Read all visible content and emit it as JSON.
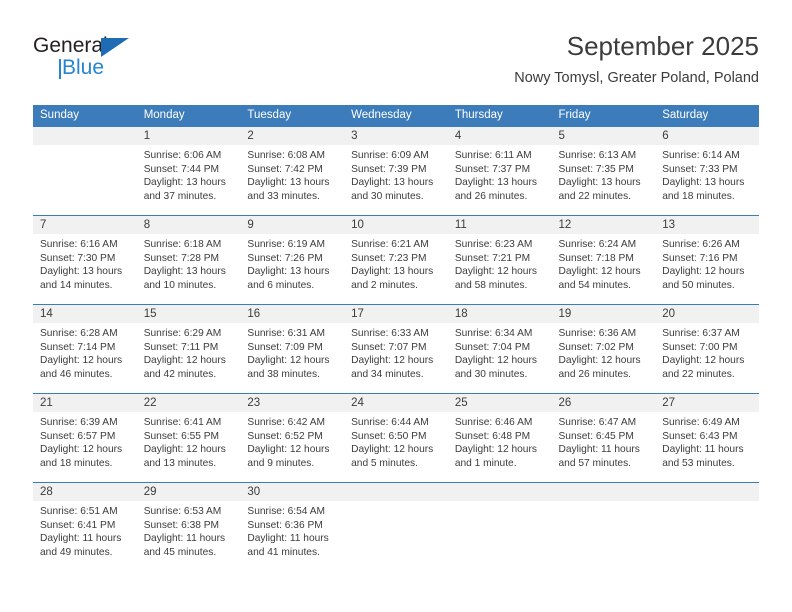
{
  "logo": {
    "primary_text": "General",
    "secondary_text": "Blue",
    "primary_color": "#231f20",
    "accent_color": "#2585d3",
    "triangle_color": "#1f6cb4"
  },
  "header": {
    "title": "September 2025",
    "subtitle": "Nowy Tomysl, Greater Poland, Poland"
  },
  "theme": {
    "header_row_bg": "#3d7cbb",
    "header_row_text": "#ffffff",
    "day_number_bg": "#f1f1f1",
    "cell_text": "#3c3c3c",
    "grid_line": "#3d7cbb"
  },
  "weekday_headers": [
    "Sunday",
    "Monday",
    "Tuesday",
    "Wednesday",
    "Thursday",
    "Friday",
    "Saturday"
  ],
  "weeks": [
    [
      {
        "day": "",
        "sunrise": "",
        "sunset": "",
        "daylight_line1": "",
        "daylight_line2": ""
      },
      {
        "day": "1",
        "sunrise": "Sunrise: 6:06 AM",
        "sunset": "Sunset: 7:44 PM",
        "daylight_line1": "Daylight: 13 hours",
        "daylight_line2": "and 37 minutes."
      },
      {
        "day": "2",
        "sunrise": "Sunrise: 6:08 AM",
        "sunset": "Sunset: 7:42 PM",
        "daylight_line1": "Daylight: 13 hours",
        "daylight_line2": "and 33 minutes."
      },
      {
        "day": "3",
        "sunrise": "Sunrise: 6:09 AM",
        "sunset": "Sunset: 7:39 PM",
        "daylight_line1": "Daylight: 13 hours",
        "daylight_line2": "and 30 minutes."
      },
      {
        "day": "4",
        "sunrise": "Sunrise: 6:11 AM",
        "sunset": "Sunset: 7:37 PM",
        "daylight_line1": "Daylight: 13 hours",
        "daylight_line2": "and 26 minutes."
      },
      {
        "day": "5",
        "sunrise": "Sunrise: 6:13 AM",
        "sunset": "Sunset: 7:35 PM",
        "daylight_line1": "Daylight: 13 hours",
        "daylight_line2": "and 22 minutes."
      },
      {
        "day": "6",
        "sunrise": "Sunrise: 6:14 AM",
        "sunset": "Sunset: 7:33 PM",
        "daylight_line1": "Daylight: 13 hours",
        "daylight_line2": "and 18 minutes."
      }
    ],
    [
      {
        "day": "7",
        "sunrise": "Sunrise: 6:16 AM",
        "sunset": "Sunset: 7:30 PM",
        "daylight_line1": "Daylight: 13 hours",
        "daylight_line2": "and 14 minutes."
      },
      {
        "day": "8",
        "sunrise": "Sunrise: 6:18 AM",
        "sunset": "Sunset: 7:28 PM",
        "daylight_line1": "Daylight: 13 hours",
        "daylight_line2": "and 10 minutes."
      },
      {
        "day": "9",
        "sunrise": "Sunrise: 6:19 AM",
        "sunset": "Sunset: 7:26 PM",
        "daylight_line1": "Daylight: 13 hours",
        "daylight_line2": "and 6 minutes."
      },
      {
        "day": "10",
        "sunrise": "Sunrise: 6:21 AM",
        "sunset": "Sunset: 7:23 PM",
        "daylight_line1": "Daylight: 13 hours",
        "daylight_line2": "and 2 minutes."
      },
      {
        "day": "11",
        "sunrise": "Sunrise: 6:23 AM",
        "sunset": "Sunset: 7:21 PM",
        "daylight_line1": "Daylight: 12 hours",
        "daylight_line2": "and 58 minutes."
      },
      {
        "day": "12",
        "sunrise": "Sunrise: 6:24 AM",
        "sunset": "Sunset: 7:18 PM",
        "daylight_line1": "Daylight: 12 hours",
        "daylight_line2": "and 54 minutes."
      },
      {
        "day": "13",
        "sunrise": "Sunrise: 6:26 AM",
        "sunset": "Sunset: 7:16 PM",
        "daylight_line1": "Daylight: 12 hours",
        "daylight_line2": "and 50 minutes."
      }
    ],
    [
      {
        "day": "14",
        "sunrise": "Sunrise: 6:28 AM",
        "sunset": "Sunset: 7:14 PM",
        "daylight_line1": "Daylight: 12 hours",
        "daylight_line2": "and 46 minutes."
      },
      {
        "day": "15",
        "sunrise": "Sunrise: 6:29 AM",
        "sunset": "Sunset: 7:11 PM",
        "daylight_line1": "Daylight: 12 hours",
        "daylight_line2": "and 42 minutes."
      },
      {
        "day": "16",
        "sunrise": "Sunrise: 6:31 AM",
        "sunset": "Sunset: 7:09 PM",
        "daylight_line1": "Daylight: 12 hours",
        "daylight_line2": "and 38 minutes."
      },
      {
        "day": "17",
        "sunrise": "Sunrise: 6:33 AM",
        "sunset": "Sunset: 7:07 PM",
        "daylight_line1": "Daylight: 12 hours",
        "daylight_line2": "and 34 minutes."
      },
      {
        "day": "18",
        "sunrise": "Sunrise: 6:34 AM",
        "sunset": "Sunset: 7:04 PM",
        "daylight_line1": "Daylight: 12 hours",
        "daylight_line2": "and 30 minutes."
      },
      {
        "day": "19",
        "sunrise": "Sunrise: 6:36 AM",
        "sunset": "Sunset: 7:02 PM",
        "daylight_line1": "Daylight: 12 hours",
        "daylight_line2": "and 26 minutes."
      },
      {
        "day": "20",
        "sunrise": "Sunrise: 6:37 AM",
        "sunset": "Sunset: 7:00 PM",
        "daylight_line1": "Daylight: 12 hours",
        "daylight_line2": "and 22 minutes."
      }
    ],
    [
      {
        "day": "21",
        "sunrise": "Sunrise: 6:39 AM",
        "sunset": "Sunset: 6:57 PM",
        "daylight_line1": "Daylight: 12 hours",
        "daylight_line2": "and 18 minutes."
      },
      {
        "day": "22",
        "sunrise": "Sunrise: 6:41 AM",
        "sunset": "Sunset: 6:55 PM",
        "daylight_line1": "Daylight: 12 hours",
        "daylight_line2": "and 13 minutes."
      },
      {
        "day": "23",
        "sunrise": "Sunrise: 6:42 AM",
        "sunset": "Sunset: 6:52 PM",
        "daylight_line1": "Daylight: 12 hours",
        "daylight_line2": "and 9 minutes."
      },
      {
        "day": "24",
        "sunrise": "Sunrise: 6:44 AM",
        "sunset": "Sunset: 6:50 PM",
        "daylight_line1": "Daylight: 12 hours",
        "daylight_line2": "and 5 minutes."
      },
      {
        "day": "25",
        "sunrise": "Sunrise: 6:46 AM",
        "sunset": "Sunset: 6:48 PM",
        "daylight_line1": "Daylight: 12 hours",
        "daylight_line2": "and 1 minute."
      },
      {
        "day": "26",
        "sunrise": "Sunrise: 6:47 AM",
        "sunset": "Sunset: 6:45 PM",
        "daylight_line1": "Daylight: 11 hours",
        "daylight_line2": "and 57 minutes."
      },
      {
        "day": "27",
        "sunrise": "Sunrise: 6:49 AM",
        "sunset": "Sunset: 6:43 PM",
        "daylight_line1": "Daylight: 11 hours",
        "daylight_line2": "and 53 minutes."
      }
    ],
    [
      {
        "day": "28",
        "sunrise": "Sunrise: 6:51 AM",
        "sunset": "Sunset: 6:41 PM",
        "daylight_line1": "Daylight: 11 hours",
        "daylight_line2": "and 49 minutes."
      },
      {
        "day": "29",
        "sunrise": "Sunrise: 6:53 AM",
        "sunset": "Sunset: 6:38 PM",
        "daylight_line1": "Daylight: 11 hours",
        "daylight_line2": "and 45 minutes."
      },
      {
        "day": "30",
        "sunrise": "Sunrise: 6:54 AM",
        "sunset": "Sunset: 6:36 PM",
        "daylight_line1": "Daylight: 11 hours",
        "daylight_line2": "and 41 minutes."
      },
      {
        "day": "",
        "sunrise": "",
        "sunset": "",
        "daylight_line1": "",
        "daylight_line2": ""
      },
      {
        "day": "",
        "sunrise": "",
        "sunset": "",
        "daylight_line1": "",
        "daylight_line2": ""
      },
      {
        "day": "",
        "sunrise": "",
        "sunset": "",
        "daylight_line1": "",
        "daylight_line2": ""
      },
      {
        "day": "",
        "sunrise": "",
        "sunset": "",
        "daylight_line1": "",
        "daylight_line2": ""
      }
    ]
  ]
}
